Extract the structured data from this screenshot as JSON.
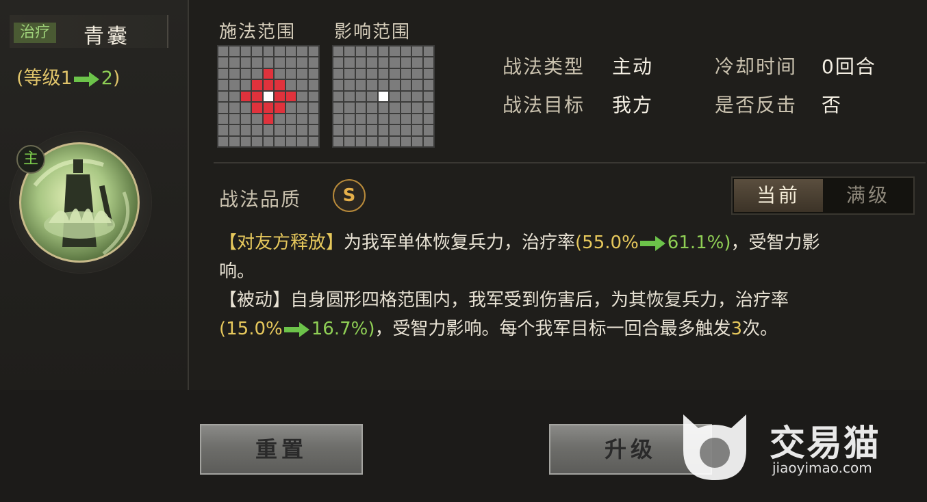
{
  "skill": {
    "category": "治疗",
    "name": "青囊",
    "level_prefix": "(等级1",
    "level_to": "2",
    "level_suffix": ")",
    "role_badge": "主"
  },
  "ranges": {
    "cast_label": "施法范围",
    "effect_label": "影响范围"
  },
  "info": {
    "type_label": "战法类型",
    "type_value": "主动",
    "cooldown_label": "冷却时间",
    "cooldown_value": "0回合",
    "target_label": "战法目标",
    "target_value": "我方",
    "counter_label": "是否反击",
    "counter_value": "否"
  },
  "quality": {
    "label": "战法品质",
    "grade": "S"
  },
  "tabs": {
    "current": "当前",
    "max": "满级"
  },
  "description": {
    "l1_tag": "【对友方释放】",
    "l1_text": "为我军单体恢复兵力，治疗率",
    "l1_from": "(55.0%",
    "l1_to": "61.1%)",
    "l1_tail": "，受智力影",
    "l2_text": "响。",
    "l3_text": "【被动】自身圆形四格范围内，我军受到伤害后，为其恢复兵力，治疗率",
    "l4_from": "(15.0%",
    "l4_to": "16.7%)",
    "l4_mid": "，受智力影响。每个我军目标一回合最多触发",
    "l4_num": "3",
    "l4_end": "次。"
  },
  "buttons": {
    "reset": "重置",
    "upgrade": "升级"
  },
  "watermark": {
    "brand": "交易猫",
    "url": "jiaoyimao.com"
  },
  "colors": {
    "accent_yellow": "#e6c85c",
    "accent_green": "#8fcf55",
    "range_red": "#e0323c"
  }
}
